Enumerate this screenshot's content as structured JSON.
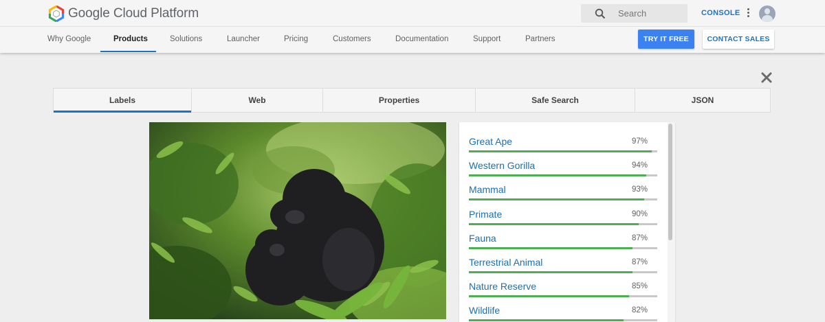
{
  "header": {
    "brand": "Google Cloud Platform",
    "search_placeholder": "Search",
    "console_label": "CONSOLE"
  },
  "nav": {
    "items": [
      {
        "label": "Why Google"
      },
      {
        "label": "Products"
      },
      {
        "label": "Solutions"
      },
      {
        "label": "Launcher"
      },
      {
        "label": "Pricing"
      },
      {
        "label": "Customers"
      },
      {
        "label": "Documentation"
      },
      {
        "label": "Support"
      },
      {
        "label": "Partners"
      }
    ],
    "active": "Products",
    "try_label": "TRY IT FREE",
    "contact_label": "CONTACT SALES"
  },
  "tabs": [
    {
      "label": "Labels"
    },
    {
      "label": "Web"
    },
    {
      "label": "Properties"
    },
    {
      "label": "Safe Search"
    },
    {
      "label": "JSON"
    }
  ],
  "active_tab": "Labels",
  "labels": [
    {
      "name": "Great Ape",
      "score": "97%",
      "value": 97
    },
    {
      "name": "Western Gorilla",
      "score": "94%",
      "value": 94
    },
    {
      "name": "Mammal",
      "score": "93%",
      "value": 93
    },
    {
      "name": "Primate",
      "score": "90%",
      "value": 90
    },
    {
      "name": "Fauna",
      "score": "87%",
      "value": 87
    },
    {
      "name": "Terrestrial Animal",
      "score": "87%",
      "value": 87
    },
    {
      "name": "Nature Reserve",
      "score": "85%",
      "value": 85
    },
    {
      "name": "Wildlife",
      "score": "82%",
      "value": 82
    }
  ],
  "icons": {
    "logo": "hexagon-logo-icon",
    "search": "search-icon",
    "menu": "more-vert-icon",
    "close": "close-icon",
    "avatar": "user-avatar"
  },
  "colors": {
    "accent": "#1a73c8",
    "primary_button": "#3b82f0",
    "bar_fill": "#4caf50",
    "label_text": "#1a6fb5"
  }
}
